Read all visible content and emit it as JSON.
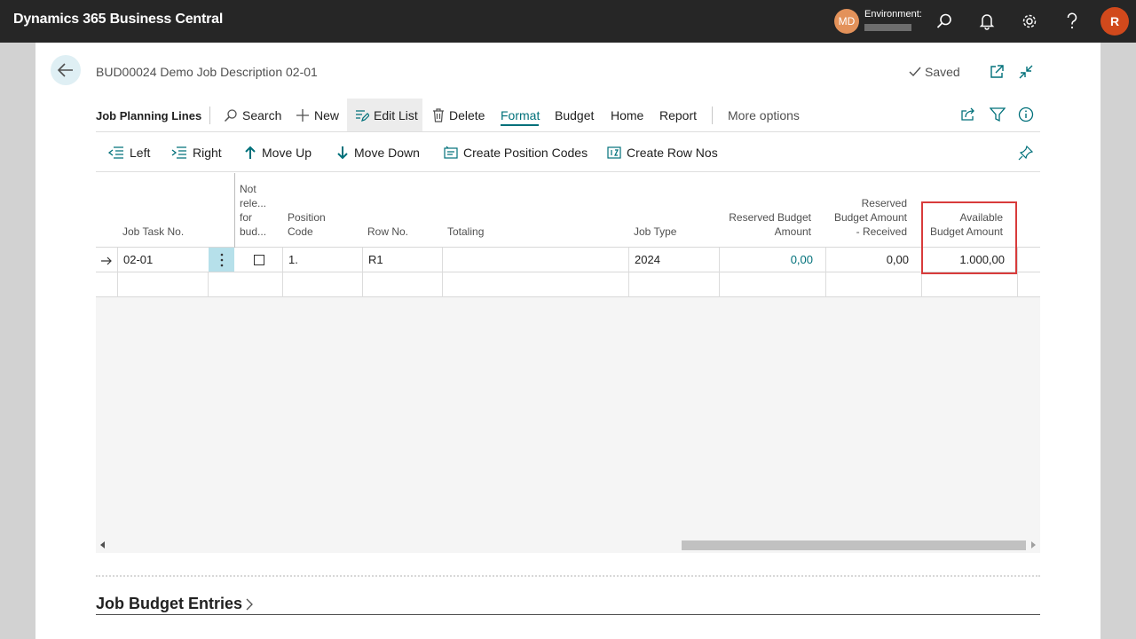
{
  "app": {
    "title": "Dynamics 365 Business Central",
    "user_initials": "MD",
    "environment_label": "Environment:",
    "profile_initial": "R"
  },
  "page": {
    "title": "BUD00024 Demo Job Description 02-01",
    "saved_label": "Saved"
  },
  "action_bar": {
    "title": "Job Planning Lines",
    "search": "Search",
    "new": "New",
    "edit_list": "Edit List",
    "delete": "Delete",
    "format": "Format",
    "budget": "Budget",
    "home": "Home",
    "report": "Report",
    "more": "More options"
  },
  "sub_actions": {
    "left": "Left",
    "right": "Right",
    "move_up": "Move Up",
    "move_down": "Move Down",
    "create_position_codes": "Create Position Codes",
    "create_row_nos": "Create Row Nos"
  },
  "grid": {
    "columns": {
      "job_task_no": "Job Task No.",
      "not_released": [
        "Not",
        "rele...",
        "for",
        "bud..."
      ],
      "position_code": [
        "Position",
        "Code"
      ],
      "row_no": "Row No.",
      "totaling": "Totaling",
      "job_type": "Job Type",
      "reserved_budget": [
        "Reserved Budget",
        "Amount"
      ],
      "reserved_received": [
        "Reserved",
        "Budget Amount",
        "- Received"
      ],
      "available": [
        "Available",
        "Budget Amount"
      ]
    },
    "rows": [
      {
        "job_task_no": "02-01",
        "not_released": false,
        "position_code": "1.",
        "row_no": "R1",
        "totaling": "",
        "job_type": "2024",
        "reserved_budget": "0,00",
        "reserved_received": "0,00",
        "available": "1.000,00"
      }
    ]
  },
  "section": {
    "title": "Job Budget Entries"
  },
  "colors": {
    "accent": "#00707a",
    "highlight": "#d83b3b",
    "topbar": "#262626"
  }
}
